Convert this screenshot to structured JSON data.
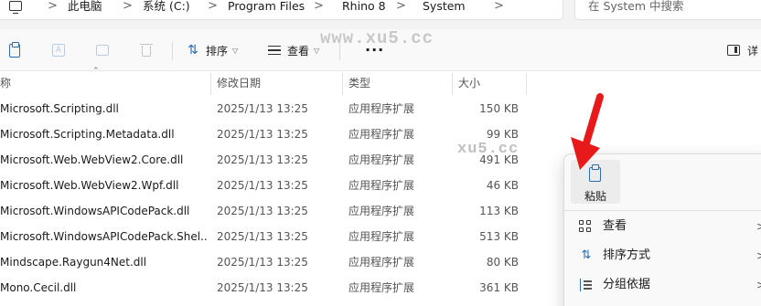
{
  "address_bar": {
    "icon": "this-pc-icon",
    "crumbs": [
      "此电脑",
      "系统 (C:)",
      "Program Files",
      "Rhino 8",
      "System"
    ],
    "separator": ">"
  },
  "search": {
    "placeholder": "在 System 中搜索"
  },
  "toolbar": {
    "sort_label": "排序",
    "view_label": "查看",
    "more_label": "···",
    "details_label": "详"
  },
  "watermarks": [
    "www.xu5.cc",
    "xu5.cc"
  ],
  "columns": {
    "name": "称",
    "date": "修改日期",
    "type": "类型",
    "size": "大小"
  },
  "files": [
    {
      "name": "Microsoft.Scripting.dll",
      "date": "2025/1/13 13:25",
      "type": "应用程序扩展",
      "size": "150 KB"
    },
    {
      "name": "Microsoft.Scripting.Metadata.dll",
      "date": "2025/1/13 13:25",
      "type": "应用程序扩展",
      "size": "99 KB"
    },
    {
      "name": "Microsoft.Web.WebView2.Core.dll",
      "date": "2025/1/13 13:25",
      "type": "应用程序扩展",
      "size": "491 KB"
    },
    {
      "name": "Microsoft.Web.WebView2.Wpf.dll",
      "date": "2025/1/13 13:25",
      "type": "应用程序扩展",
      "size": "46 KB"
    },
    {
      "name": "Microsoft.WindowsAPICodePack.dll",
      "date": "2025/1/13 13:25",
      "type": "应用程序扩展",
      "size": "113 KB"
    },
    {
      "name": "Microsoft.WindowsAPICodePack.Shel...",
      "date": "2025/1/13 13:25",
      "type": "应用程序扩展",
      "size": "513 KB"
    },
    {
      "name": "Mindscape.Raygun4Net.dll",
      "date": "2025/1/13 13:25",
      "type": "应用程序扩展",
      "size": "80 KB"
    },
    {
      "name": "Mono.Cecil.dll",
      "date": "2025/1/13 13:25",
      "type": "应用程序扩展",
      "size": "361 KB"
    }
  ],
  "context_menu": {
    "paste_label": "粘贴",
    "items": [
      {
        "label": "查看",
        "icon": "grid-view-icon",
        "has_submenu": true
      },
      {
        "label": "排序方式",
        "icon": "sort-icon",
        "has_submenu": true
      },
      {
        "label": "分组依据",
        "icon": "group-by-icon",
        "has_submenu": true
      }
    ],
    "submenu_arrow": ">"
  },
  "annotation": {
    "arrow_color": "#e8191b"
  }
}
